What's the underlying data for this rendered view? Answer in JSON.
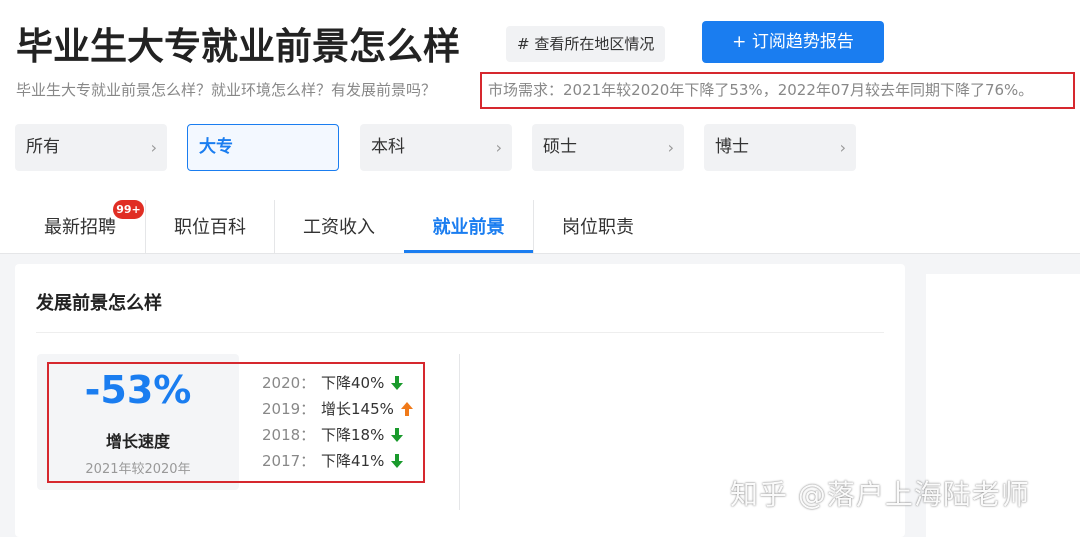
{
  "header": {
    "title": "毕业生大专就业前景怎么样",
    "region_button": "# 查看所在地区情况",
    "subscribe_button": "+ 订阅趋势报告",
    "subtitle": "毕业生大专就业前景怎么样？就业环境怎么样？有发展前景吗？",
    "market_demand": "市场需求：2021年较2020年下降了53%，2022年07月较去年同期下降了76%。"
  },
  "filters": [
    {
      "label": "所有",
      "active": false
    },
    {
      "label": "大专",
      "active": true
    },
    {
      "label": "本科",
      "active": false
    },
    {
      "label": "硕士",
      "active": false
    },
    {
      "label": "博士",
      "active": false
    }
  ],
  "tabs": [
    {
      "label": "最新招聘",
      "badge": "99+"
    },
    {
      "label": "职位百科"
    },
    {
      "label": "工资收入"
    },
    {
      "label": "就业前景",
      "active": true
    },
    {
      "label": "岗位职责"
    }
  ],
  "card": {
    "title": "发展前景怎么样",
    "stat_value": "-53%",
    "stat_label": "增长速度",
    "stat_period": "2021年较2020年",
    "history": [
      {
        "year": "2020：",
        "change": "下降40%",
        "direction": "down"
      },
      {
        "year": "2019：",
        "change": "增长145%",
        "direction": "up"
      },
      {
        "year": "2018：",
        "change": "下降18%",
        "direction": "down"
      },
      {
        "year": "2017：",
        "change": "下降41%",
        "direction": "down"
      }
    ]
  },
  "colors": {
    "accent": "#1a7df0",
    "down": "#1a9a2c",
    "up": "#f07a1a",
    "highlight": "#d6282e"
  },
  "watermark": "知乎 @落户上海陆老师"
}
